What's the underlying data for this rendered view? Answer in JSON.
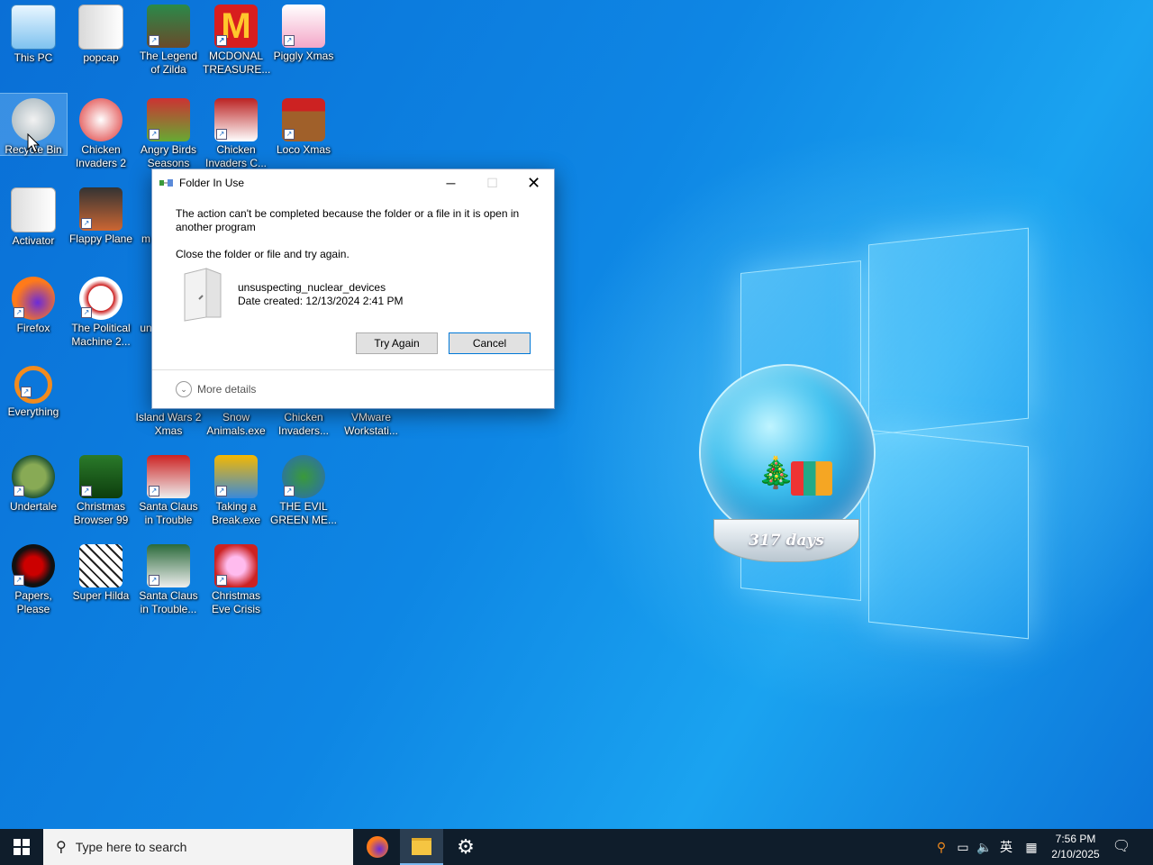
{
  "desktop": {
    "icons": [
      {
        "label": "This PC"
      },
      {
        "label": "popcap"
      },
      {
        "label": "The Legend of Zilda"
      },
      {
        "label": "MCDONAL TREASURE..."
      },
      {
        "label": "Piggly Xmas"
      },
      {
        "label": "Recycle Bin"
      },
      {
        "label": "Chicken Invaders 2"
      },
      {
        "label": "Angry Birds Seasons"
      },
      {
        "label": "Chicken Invaders C..."
      },
      {
        "label": "Loco Xmas"
      },
      {
        "label": "Activator"
      },
      {
        "label": "Flappy Plane"
      },
      {
        "label": "m"
      },
      {
        "label": "Firefox"
      },
      {
        "label": "The Political Machine 2..."
      },
      {
        "label": "un"
      },
      {
        "label": "Everything"
      },
      {
        "label": "Island Wars 2 Xmas"
      },
      {
        "label": "Snow Animals.exe"
      },
      {
        "label": "Chicken Invaders..."
      },
      {
        "label": "VMware Workstati..."
      },
      {
        "label": "Undertale"
      },
      {
        "label": "Christmas Browser 99"
      },
      {
        "label": "Santa Claus in Trouble"
      },
      {
        "label": "Taking a Break.exe"
      },
      {
        "label": "THE EVIL GREEN ME..."
      },
      {
        "label": "Papers, Please"
      },
      {
        "label": "Super Hilda"
      },
      {
        "label": "Santa Claus in Trouble..."
      },
      {
        "label": "Christmas Eve Crisis"
      }
    ],
    "widget": {
      "days_label": "317 days"
    }
  },
  "dialog": {
    "title": "Folder In Use",
    "message": "The action can't be completed because the folder or a file in it is open in another program",
    "instruction": "Close the folder or file and try again.",
    "file_name": "unsuspecting_nuclear_devices",
    "date_created": "Date created: 12/13/2024 2:41 PM",
    "try_again_label": "Try Again",
    "cancel_label": "Cancel",
    "more_details_label": "More details"
  },
  "taskbar": {
    "search_placeholder": "Type here to search",
    "ime_label": "英",
    "time": "7:56 PM",
    "date": "2/10/2025"
  },
  "colors": {
    "accent": "#0078d7",
    "taskbar": "#0f1d2b"
  }
}
